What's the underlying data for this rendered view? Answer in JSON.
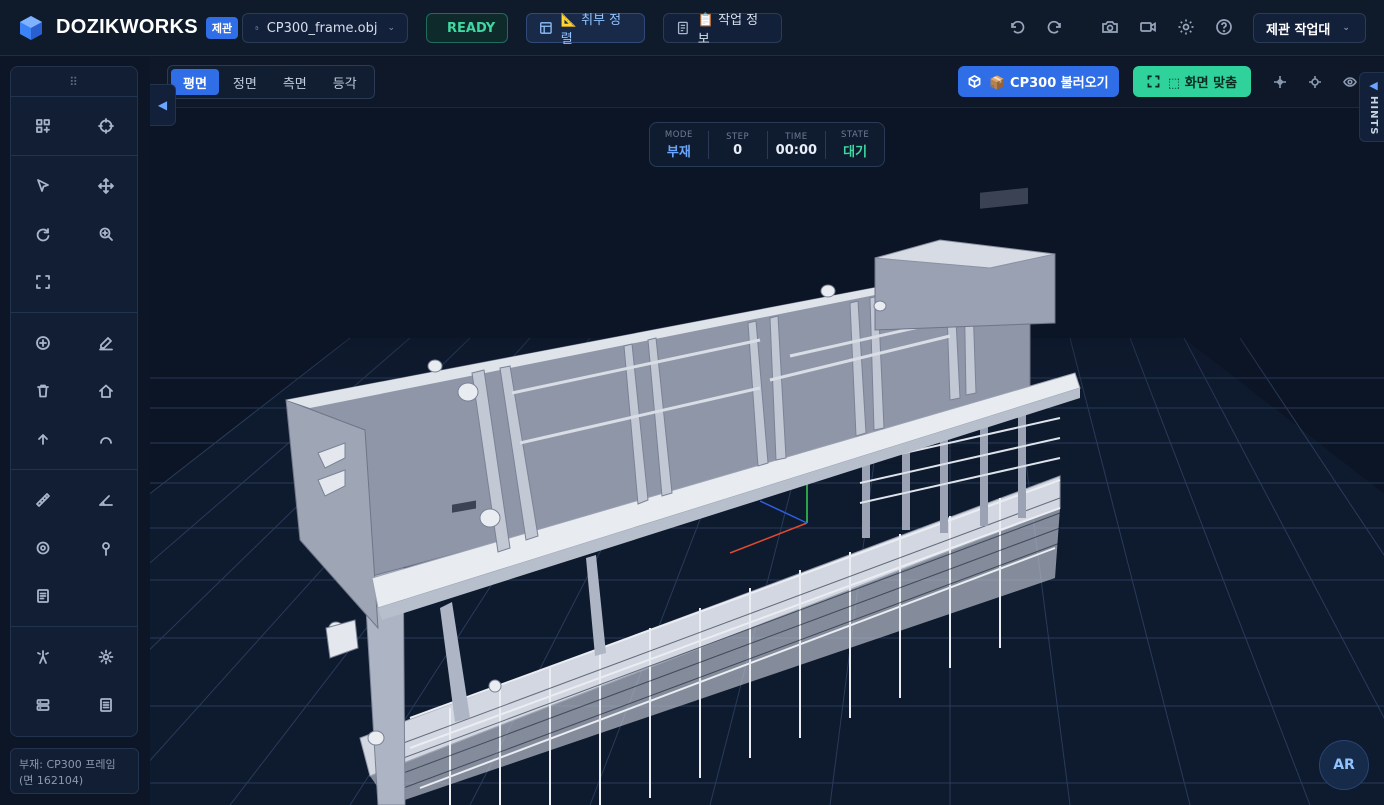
{
  "app": {
    "brand": "DOZIKWORKS",
    "brand_badge": "제관"
  },
  "toolbar": {
    "file_name": "CP300_frame.obj",
    "status": "READY",
    "align_label": "📐 취부 정렬",
    "info_label": "📋 작업 정보",
    "station_label": "제관 작업대"
  },
  "viewport": {
    "tabs": [
      "평면",
      "정면",
      "측면",
      "등각"
    ],
    "active_tab": "평면",
    "load_button": "📦 CP300 불러오기",
    "fit_button": "⬚ 화면 맞춤",
    "hints_tab": "HINTS",
    "ar_button": "AR"
  },
  "hud": {
    "mode_key": "MODE",
    "mode_value": "부재",
    "step_key": "STEP",
    "step_value": "0",
    "time_key": "TIME",
    "time_value": "00:00",
    "state_key": "STATE",
    "state_value": "대기"
  },
  "status": {
    "line1": "부재: CP300 프레임",
    "line2": "(면 162104)"
  },
  "colors": {
    "primary": "#2f6ee6",
    "success": "#2fd29a",
    "model": "#c5cad6"
  }
}
